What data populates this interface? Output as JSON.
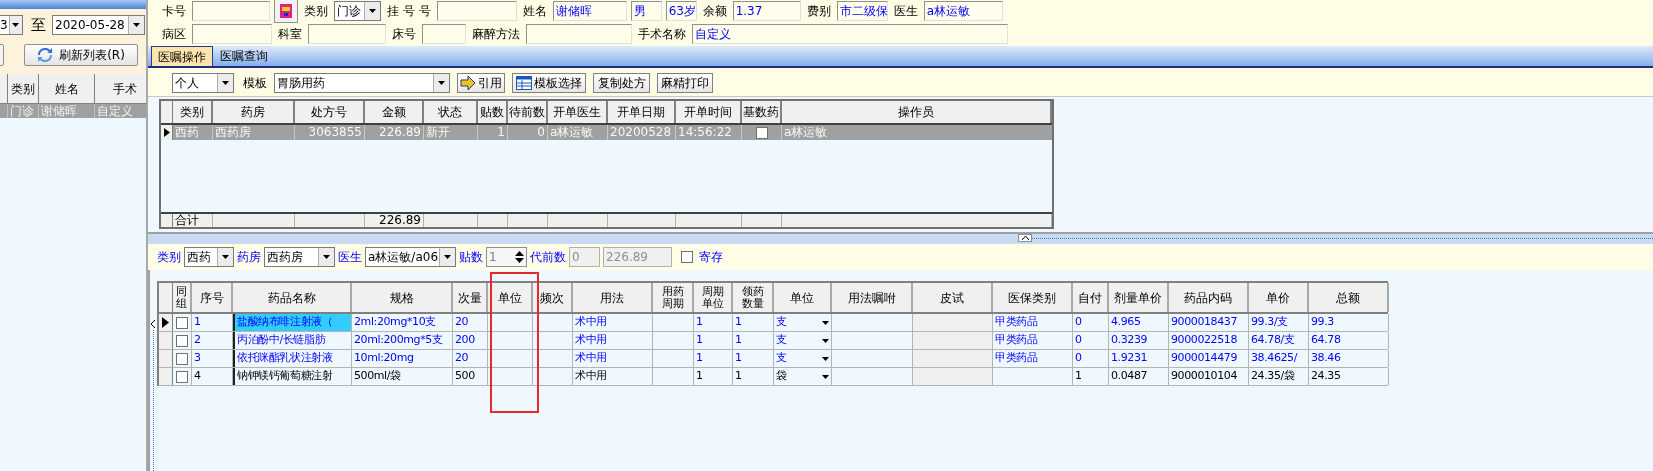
{
  "left_panel": {
    "date_from": "3",
    "to_label": "至",
    "date_to": "2020-05-28",
    "refresh_button": "刷新列表(R)",
    "list_columns": [
      "类别",
      "姓名",
      "手术"
    ],
    "list_rows": [
      {
        "cells": [
          "门诊",
          "谢储晖",
          "自定义"
        ],
        "selected": true
      }
    ]
  },
  "patient_row_1": [
    {
      "kind": "label",
      "text": "卡号"
    },
    {
      "kind": "field"
    },
    {
      "kind": "card_button"
    },
    {
      "kind": "label",
      "text": "类别"
    },
    {
      "kind": "combo",
      "value": "门诊"
    },
    {
      "kind": "label",
      "text": "挂 号 号"
    },
    {
      "kind": "field"
    },
    {
      "kind": "label",
      "text": "姓名"
    },
    {
      "kind": "field",
      "value": "谢储晖"
    },
    {
      "kind": "field",
      "value": "男"
    },
    {
      "kind": "field",
      "value": "63岁"
    },
    {
      "kind": "label",
      "text": "余额"
    },
    {
      "kind": "field",
      "value": "1.37"
    },
    {
      "kind": "label",
      "text": "费别"
    },
    {
      "kind": "field",
      "value": "市二级保"
    },
    {
      "kind": "label",
      "text": "医生"
    },
    {
      "kind": "field",
      "value": "a林运敏"
    }
  ],
  "patient_row_2": [
    {
      "kind": "label",
      "text": "病区"
    },
    {
      "kind": "field"
    },
    {
      "kind": "label",
      "text": "科室"
    },
    {
      "kind": "field"
    },
    {
      "kind": "label",
      "text": "床号"
    },
    {
      "kind": "field"
    },
    {
      "kind": "label",
      "text": "麻醉方法"
    },
    {
      "kind": "field"
    },
    {
      "kind": "label",
      "text": "手术名称"
    },
    {
      "kind": "field",
      "value": "自定义"
    }
  ],
  "tabs": [
    {
      "label": "医嘱操作",
      "selected": true
    },
    {
      "label": "医嘱查询",
      "selected": false
    }
  ],
  "toolbar": {
    "scope": "个人",
    "template_label": "模板",
    "template": "胃肠用药",
    "buttons": [
      {
        "label": "引用",
        "kind": "quote"
      },
      {
        "label": "模板选择",
        "kind": "template"
      },
      {
        "label": "复制处方",
        "kind": "plain"
      },
      {
        "label": "麻精打印",
        "kind": "plain"
      }
    ]
  },
  "prescriptions": {
    "columns": [
      "类别",
      "药房",
      "处方号",
      "金额",
      "状态",
      "贴数",
      "待前数",
      "开单医生",
      "开单日期",
      "开单时间",
      "基数药",
      "操作员"
    ],
    "rows": [
      {
        "cells": [
          "西药",
          "西药房",
          "3063855",
          "226.89",
          "新开",
          "1",
          "0",
          "a林运敏",
          "20200528",
          "14:56:22"
        ],
        "base_drug": false,
        "operator": "a林运敏",
        "selected": true
      }
    ],
    "total_label": "合计",
    "total_amount": "226.89"
  },
  "order_form": {
    "category_label": "类别",
    "category": "西药",
    "pharmacy_label": "药房",
    "pharmacy": "西药房",
    "doctor_label": "医生",
    "doctor": "a林运敏/a06",
    "doses_label": "贴数",
    "doses": "1",
    "decoct_label": "代前数",
    "decoct": "0",
    "amount": "226.89",
    "deposit_label": "寄存",
    "deposit": false
  },
  "drugs": {
    "columns": [
      "同组",
      "序号",
      "药品名称",
      "规格",
      "次量",
      "单位",
      "频次",
      "用法",
      "用药周期",
      "周期单位",
      "领药数量",
      "单位",
      "用法嘱咐",
      "皮试",
      "医保类别",
      "自付",
      "剂量单价",
      "药品内码",
      "单价",
      "总额"
    ],
    "rows": [
      {
        "grouped": false,
        "selected": true,
        "color": "#0000ff",
        "no": "1",
        "name": "盐酸纳布啡注射液（",
        "spec": "2ml:20mg*10支",
        "dose": "20",
        "usage": "术中用",
        "cycle_unit": "1",
        "qty": "1",
        "unit": "支",
        "insurance": "甲类药品",
        "self_pay": "0",
        "dose_price": "4.965",
        "code": "9000018437",
        "price": "99.3/支",
        "total": "99.3"
      },
      {
        "grouped": false,
        "selected": false,
        "color": "#0000ff",
        "no": "2",
        "name": "丙泊酚中/长链脂肪",
        "spec": "20ml:200mg*5支",
        "dose": "200",
        "usage": "术中用",
        "cycle_unit": "1",
        "qty": "1",
        "unit": "支",
        "insurance": "甲类药品",
        "self_pay": "0",
        "dose_price": "0.3239",
        "code": "9000022518",
        "price": "64.78/支",
        "total": "64.78"
      },
      {
        "grouped": false,
        "selected": false,
        "color": "#0000ff",
        "no": "3",
        "name": "依托咪酯乳状注射液",
        "spec": "10ml:20mg",
        "dose": "20",
        "usage": "术中用",
        "cycle_unit": "1",
        "qty": "1",
        "unit": "支",
        "insurance": "甲类药品",
        "self_pay": "0",
        "dose_price": "1.9231",
        "code": "9000014479",
        "price": "38.4625/",
        "total": "38.46"
      },
      {
        "grouped": false,
        "selected": false,
        "color": "#000000",
        "no": "4",
        "name": "钠钾镁钙葡萄糖注射",
        "spec": "500ml/袋",
        "dose": "500",
        "usage": "术中用",
        "cycle_unit": "1",
        "qty": "1",
        "unit": "袋",
        "self_pay": "1",
        "dose_price": "0.0487",
        "code": "9000010104",
        "price": "24.35/袋",
        "total": "24.35"
      }
    ]
  }
}
